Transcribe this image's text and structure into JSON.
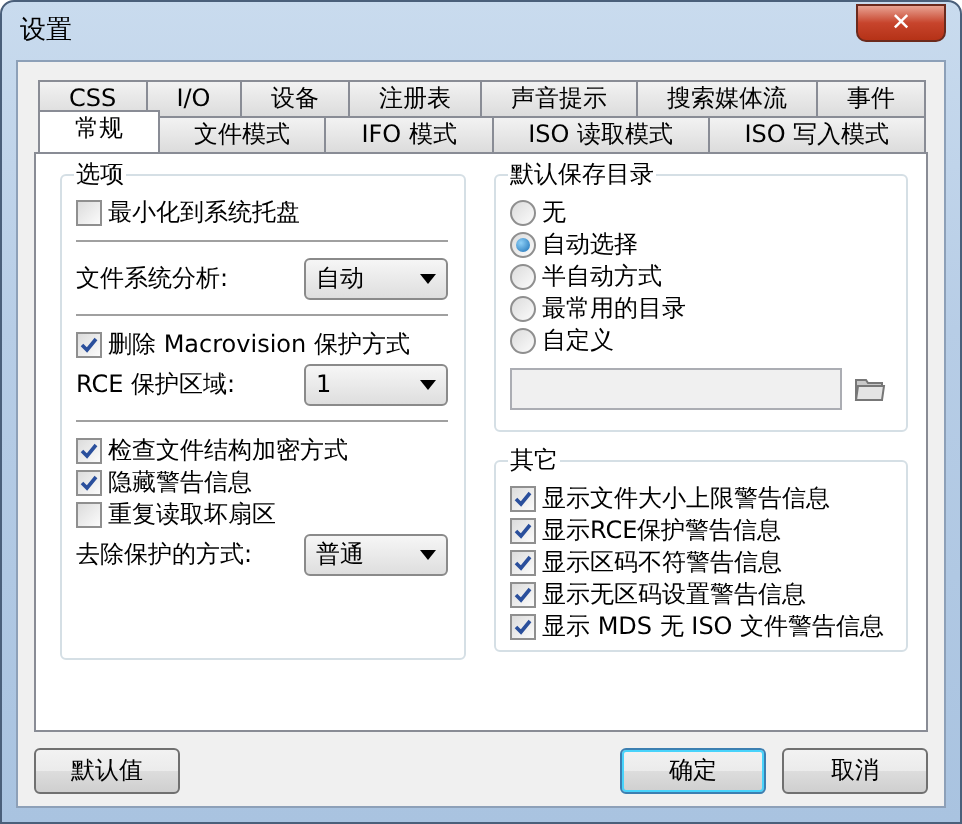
{
  "window": {
    "title": "设置",
    "close": "✕"
  },
  "tab_rows": [
    [
      {
        "label": "CSS",
        "selected": false
      },
      {
        "label": "I/O",
        "selected": false
      },
      {
        "label": "设备",
        "selected": false
      },
      {
        "label": "注册表",
        "selected": false
      },
      {
        "label": "声音提示",
        "selected": false
      },
      {
        "label": "搜索媒体流",
        "selected": false
      },
      {
        "label": "事件",
        "selected": false
      }
    ],
    [
      {
        "label": "常规",
        "selected": true
      },
      {
        "label": "文件模式",
        "selected": false
      },
      {
        "label": "IFO 模式",
        "selected": false
      },
      {
        "label": "ISO 读取模式",
        "selected": false
      },
      {
        "label": "ISO 写入模式",
        "selected": false
      }
    ]
  ],
  "options": {
    "title": "选项",
    "sections": [
      [
        {
          "kind": "checkbox",
          "label": "最小化到系统托盘",
          "checked": false
        }
      ],
      [
        {
          "kind": "select",
          "label": "文件系统分析:",
          "value": "自动"
        }
      ],
      [
        {
          "kind": "checkbox",
          "label": "删除 Macrovision 保护方式",
          "checked": true
        },
        {
          "kind": "select",
          "label": "RCE 保护区域:",
          "value": "1"
        }
      ],
      [
        {
          "kind": "checkbox",
          "label": "检查文件结构加密方式",
          "checked": true
        },
        {
          "kind": "checkbox",
          "label": "隐藏警告信息",
          "checked": true
        },
        {
          "kind": "checkbox",
          "label": "重复读取坏扇区",
          "checked": false
        },
        {
          "kind": "select",
          "label": "去除保护的方式:",
          "value": "普通"
        }
      ]
    ]
  },
  "save_dir": {
    "title": "默认保存目录",
    "choices": [
      {
        "label": "无",
        "selected": false
      },
      {
        "label": "自动选择",
        "selected": true
      },
      {
        "label": "半自动方式",
        "selected": false
      },
      {
        "label": "最常用的目录",
        "selected": false
      },
      {
        "label": "自定义",
        "selected": false
      }
    ],
    "path_disabled": true
  },
  "other": {
    "title": "其它",
    "items": [
      {
        "label": "显示文件大小上限警告信息",
        "checked": true
      },
      {
        "label": "显示RCE保护警告信息",
        "checked": true
      },
      {
        "label": "显示区码不符警告信息",
        "checked": true
      },
      {
        "label": "显示无区码设置警告信息",
        "checked": true
      },
      {
        "label": "显示 MDS 无 ISO 文件警告信息",
        "checked": true
      }
    ]
  },
  "buttons": [
    {
      "label": "默认值",
      "kind": "left"
    },
    {
      "label": "确定",
      "kind": "default"
    },
    {
      "label": "取消",
      "kind": "normal"
    }
  ]
}
